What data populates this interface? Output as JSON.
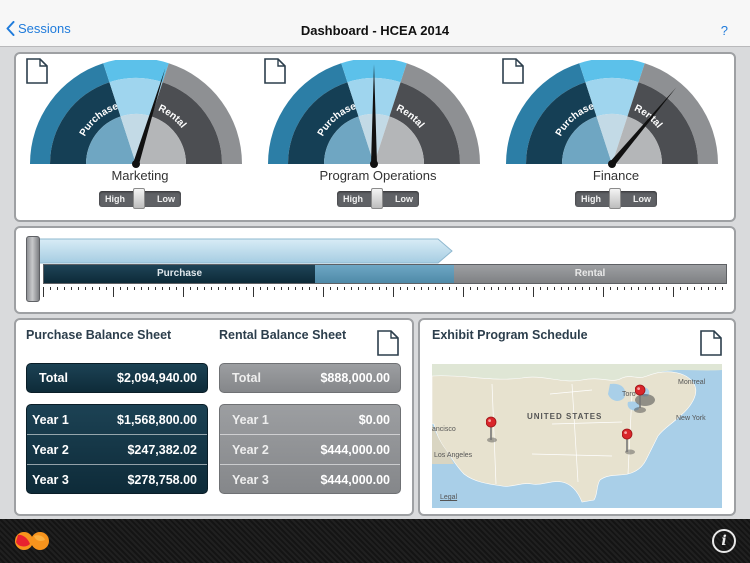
{
  "nav": {
    "back_label": "Sessions",
    "title": "Dashboard - HCEA 2014",
    "help_label": "?"
  },
  "gauges": [
    {
      "label": "Marketing",
      "left_zone": "Purchase",
      "right_zone": "Rental",
      "needle_deg": 17,
      "toggle": {
        "high": "High",
        "low": "Low"
      }
    },
    {
      "label": "Program Operations",
      "left_zone": "Purchase",
      "right_zone": "Rental",
      "needle_deg": 0,
      "toggle": {
        "high": "High",
        "low": "Low"
      }
    },
    {
      "label": "Finance",
      "left_zone": "Purchase",
      "right_zone": "Rental",
      "needle_deg": 40,
      "toggle": {
        "high": "High",
        "low": "Low"
      }
    }
  ],
  "allocation_bar": {
    "purchase_label": "Purchase",
    "rental_label": "Rental"
  },
  "purchase_sheet": {
    "title": "Purchase Balance Sheet",
    "total_label": "Total",
    "total_value": "$2,094,940.00",
    "years": [
      {
        "label": "Year 1",
        "value": "$1,568,800.00"
      },
      {
        "label": "Year 2",
        "value": "$247,382.02"
      },
      {
        "label": "Year 3",
        "value": "$278,758.00"
      }
    ]
  },
  "rental_sheet": {
    "title": "Rental Balance Sheet",
    "total_label": "Total",
    "total_value": "$888,000.00",
    "years": [
      {
        "label": "Year 1",
        "value": "$0.00"
      },
      {
        "label": "Year 2",
        "value": "$444,000.00"
      },
      {
        "label": "Year 3",
        "value": "$444,000.00"
      }
    ]
  },
  "schedule": {
    "title": "Exhibit Program Schedule",
    "map_labels": {
      "country": "UNITED STATES",
      "montreal": "Montreal",
      "toronto": "Toro",
      "new_york": "New York",
      "san_francisco": "ancisco",
      "los_angeles": "Los Angeles",
      "legal": "Legal"
    }
  },
  "colors": {
    "accent": "#1f7bdb",
    "purchase_dark": "#0e2b39",
    "rental_grey": "#85878a"
  }
}
